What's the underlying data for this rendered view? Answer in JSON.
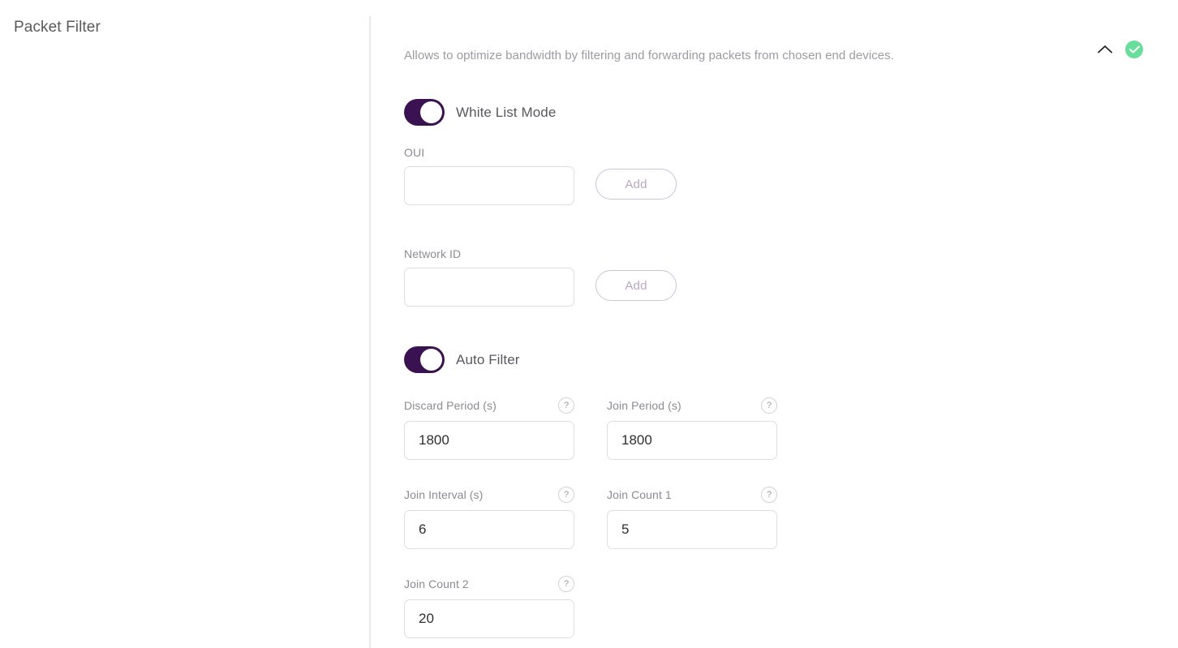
{
  "page": {
    "title": "Packet Filter"
  },
  "section": {
    "description": "Allows to optimize bandwidth by filtering and forwarding packets from chosen end devices.",
    "collapse_icon": "chevron-up-icon",
    "status_icon": "check-circle-icon",
    "status_color": "#69dd9a",
    "accent_color": "#3a1151"
  },
  "toggles": {
    "white_list_mode": {
      "label": "White List Mode",
      "state": "on"
    },
    "auto_filter": {
      "label": "Auto Filter",
      "state": "on"
    }
  },
  "fields": {
    "oui": {
      "label": "OUI",
      "value": "",
      "placeholder": "",
      "button_label": "Add"
    },
    "network_id": {
      "label": "Network ID",
      "value": "",
      "placeholder": "",
      "button_label": "Add"
    },
    "discard_period": {
      "label": "Discard Period (s)",
      "value": "1800",
      "help": "?"
    },
    "join_period": {
      "label": "Join Period (s)",
      "value": "1800",
      "help": "?"
    },
    "join_interval": {
      "label": "Join Interval (s)",
      "value": "6",
      "help": "?"
    },
    "join_count_1": {
      "label": "Join Count 1",
      "value": "5",
      "help": "?"
    },
    "join_count_2": {
      "label": "Join Count 2",
      "value": "20",
      "help": "?"
    }
  }
}
